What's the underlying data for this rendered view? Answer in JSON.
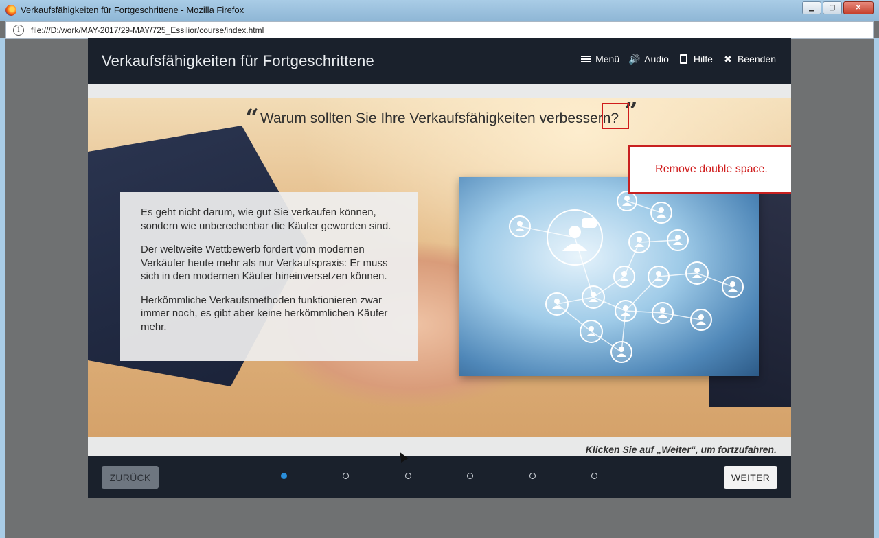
{
  "window": {
    "title": "Verkaufsfähigkeiten für Fortgeschrittene - Mozilla Firefox",
    "controls": {
      "minimize": "▁",
      "maximize": "▢",
      "close": "✕"
    }
  },
  "address": {
    "info": "i",
    "url": "file:///D:/work/MAY-2017/29-MAY/725_Essilior/course/index.html"
  },
  "header": {
    "title": "Verkaufsfähigkeiten für Fortgeschrittene",
    "nav": {
      "menu": "Menü",
      "audio": "Audio",
      "help": "Hilfe",
      "exit": "Beenden",
      "audio_icon": "🔊",
      "exit_icon": "✖"
    }
  },
  "content": {
    "quote_open": "“",
    "quote_close": "”",
    "quote": "Warum sollten Sie Ihre Verkaufsfähigkeiten verbessern?",
    "paragraphs": [
      "Es geht nicht darum, wie gut Sie verkaufen können, sondern wie unberechenbar die Käufer geworden sind.",
      "Der weltweite Wettbewerb fordert vom modernen Verkäufer heute mehr als nur Verkaufspraxis: Er muss sich in den modernen Käufer hineinversetzen können.",
      "Herkömmliche Verkaufsmethoden funktionieren zwar immer noch, es gibt aber keine herkömmlichen Käufer mehr."
    ],
    "review_comment": "Remove double space."
  },
  "footer": {
    "hint": "Klicken Sie auf „Weiter“, um fortzufahren.",
    "back": "ZURÜCK",
    "next": "WEITER",
    "pages_total": 6,
    "current_page": 1
  },
  "icons": [
    "firefox-icon",
    "info-icon",
    "menu-icon",
    "audio-icon",
    "help-book-icon",
    "exit-icon",
    "network-people-icon"
  ]
}
